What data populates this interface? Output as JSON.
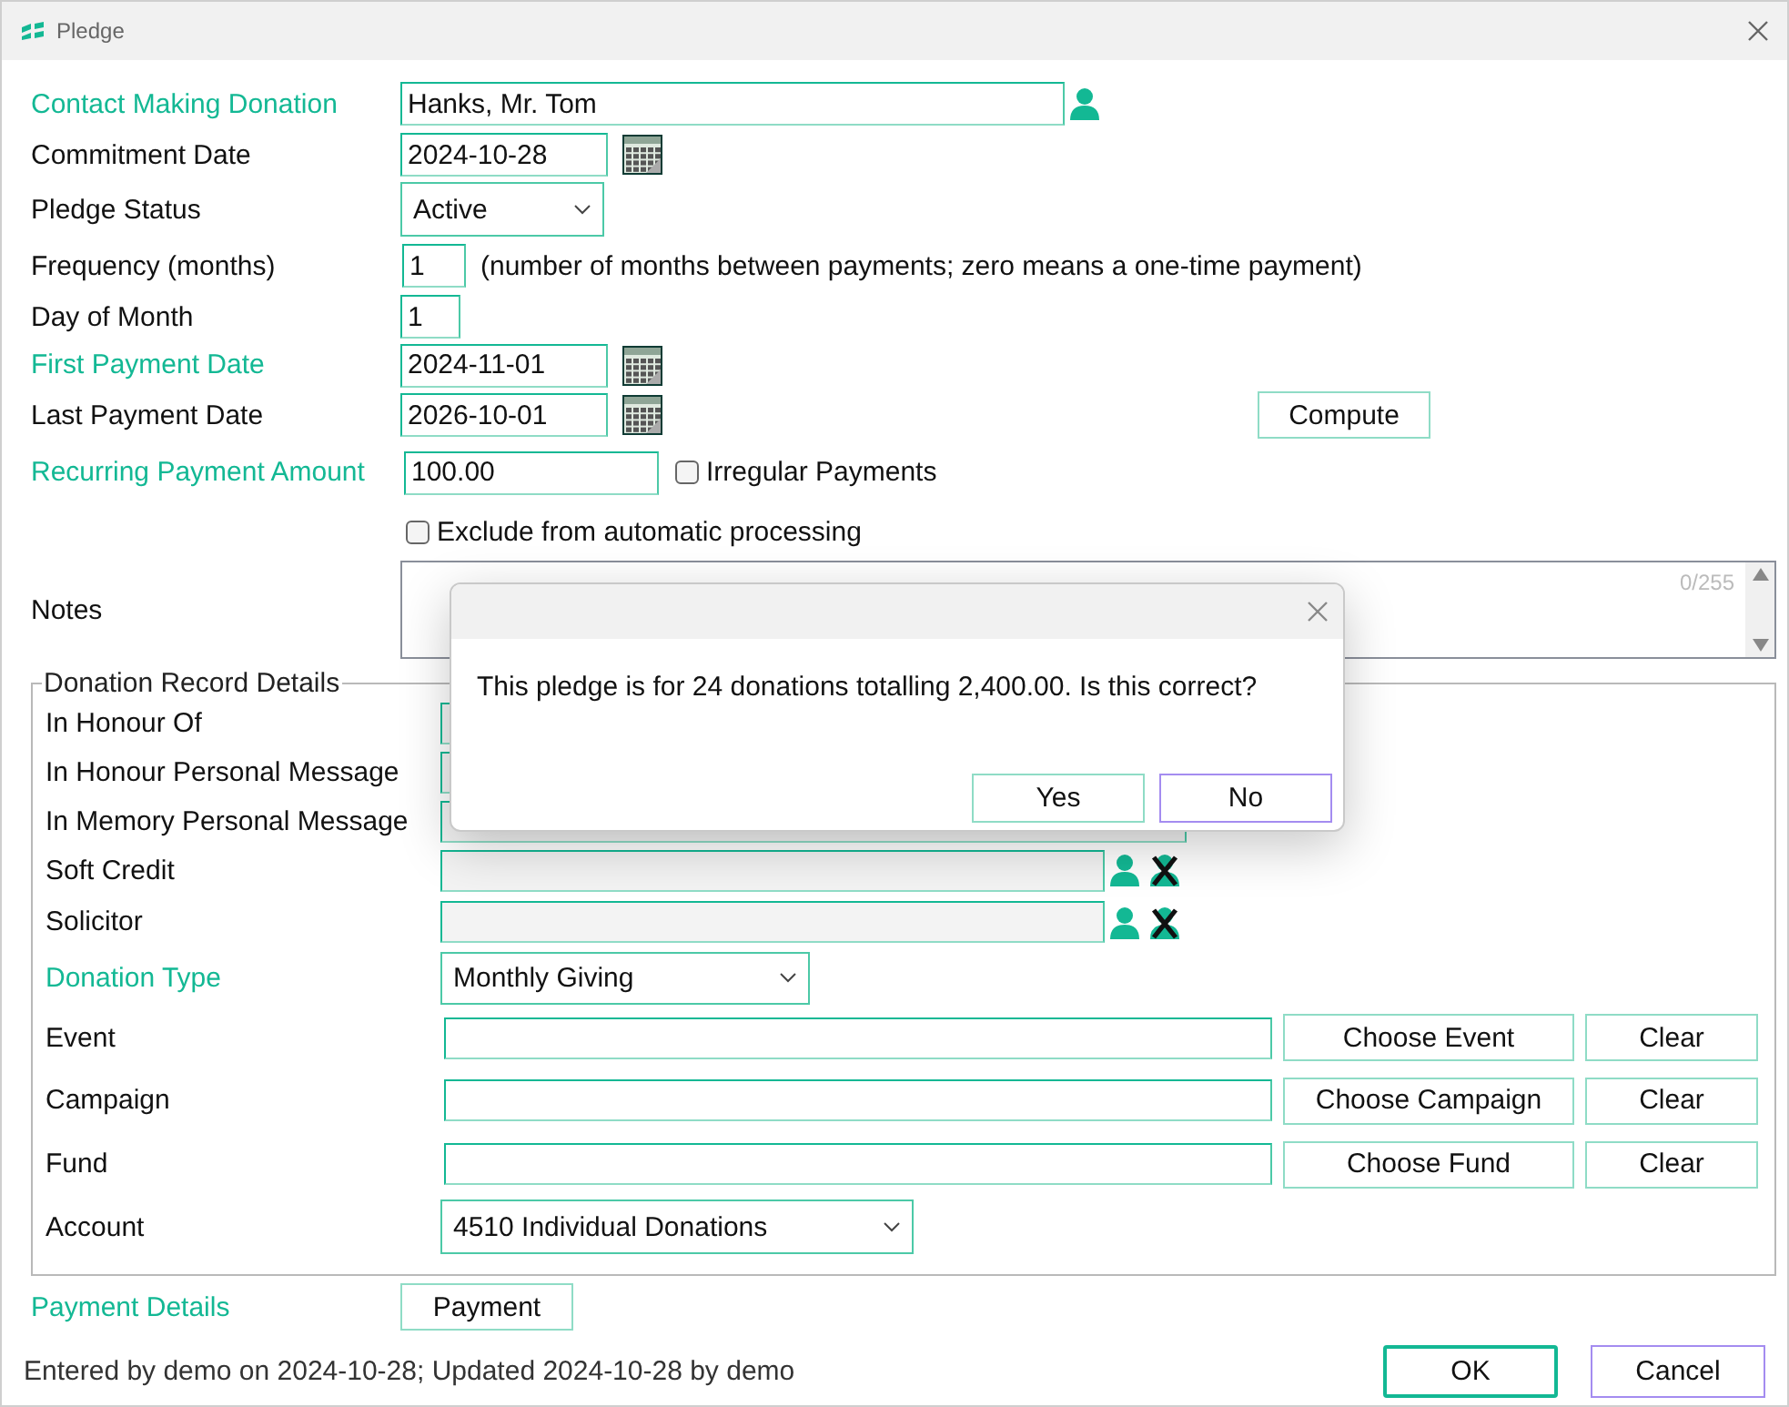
{
  "window": {
    "title": "Pledge"
  },
  "contact": {
    "label": "Contact Making Donation",
    "highlighted": true,
    "value": "Hanks, Mr. Tom"
  },
  "commitment_date": {
    "label": "Commitment Date",
    "highlighted": false,
    "value": "2024-10-28"
  },
  "pledge_status": {
    "label": "Pledge Status",
    "highlighted": false,
    "value": "Active"
  },
  "frequency": {
    "label": "Frequency (months)",
    "highlighted": false,
    "value": "1",
    "hint": "(number of months between payments; zero means a one-time payment)"
  },
  "day_of_month": {
    "label": "Day of Month",
    "highlighted": false,
    "value": "1"
  },
  "first_payment_date": {
    "label": "First Payment Date",
    "highlighted": true,
    "value": "2024-11-01"
  },
  "last_payment_date": {
    "label": "Last Payment Date",
    "highlighted": false,
    "value": "2026-10-01"
  },
  "compute_button": "Compute",
  "recurring_amount": {
    "label": "Recurring Payment Amount",
    "highlighted": true,
    "value": "100.00"
  },
  "irregular_payments": {
    "label": "Irregular Payments",
    "checked": false
  },
  "exclude_processing": {
    "label": "Exclude from automatic processing",
    "checked": false
  },
  "notes": {
    "label": "Notes",
    "highlighted": false,
    "counter": "0/255"
  },
  "donation_record": {
    "title": "Donation Record Details",
    "rows": [
      {
        "kind": "text",
        "label": "In Honour Of",
        "highlighted": false
      },
      {
        "kind": "text",
        "label": "In Honour Personal Message",
        "highlighted": false
      },
      {
        "kind": "text",
        "label": "In Memory Personal Message",
        "highlighted": false
      },
      {
        "kind": "contact",
        "label": "Soft Credit",
        "highlighted": false
      },
      {
        "kind": "contact",
        "label": "Solicitor",
        "highlighted": false
      },
      {
        "kind": "select",
        "label": "Donation Type",
        "highlighted": true,
        "value": "Monthly Giving"
      },
      {
        "kind": "chooser",
        "label": "Event",
        "highlighted": false,
        "buttons": [
          "Choose Event",
          "Clear"
        ]
      },
      {
        "kind": "chooser",
        "label": "Campaign",
        "highlighted": false,
        "buttons": [
          "Choose Campaign",
          "Clear"
        ]
      },
      {
        "kind": "chooser",
        "label": "Fund",
        "highlighted": false,
        "buttons": [
          "Choose Fund",
          "Clear"
        ]
      },
      {
        "kind": "wideselect",
        "label": "Account",
        "highlighted": false,
        "value": "4510 Individual Donations"
      }
    ]
  },
  "payment_details": {
    "label": "Payment Details",
    "highlighted": true,
    "button": "Payment"
  },
  "footer": {
    "text": "Entered by demo on 2024-10-28; Updated 2024-10-28 by demo",
    "buttons": [
      {
        "label": "OK",
        "kind": "default"
      },
      {
        "label": "Cancel",
        "kind": "focused"
      }
    ]
  },
  "dialog": {
    "message": "This pledge is for 24 donations totalling 2,400.00. Is this correct?",
    "buttons": [
      {
        "label": "Yes",
        "kind": "plain"
      },
      {
        "label": "No",
        "kind": "focused"
      }
    ]
  }
}
